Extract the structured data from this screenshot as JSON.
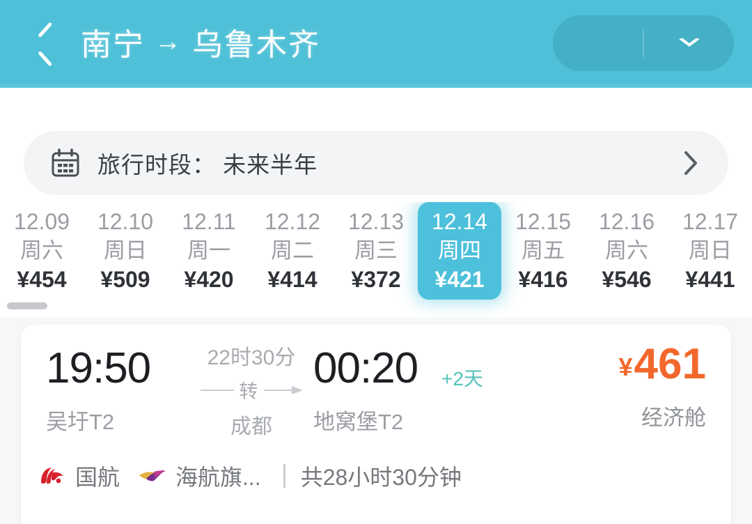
{
  "theme": {
    "header_teal": "#4EC0D7",
    "selected_teal": "#4DC0DB",
    "price_orange": "#F2682C",
    "accent_green": "#55C3BB",
    "muted_gray": "#9A9DA3"
  },
  "header": {
    "back_icon": "chevron-left-icon",
    "origin": "南宁",
    "arrow": "→",
    "destination": "乌鲁木齐",
    "capsule_menu_icon": "chevron-down-icon"
  },
  "filter": {
    "calendar_icon": "calendar-icon",
    "label": "旅行时段： 未来半年",
    "chevron_icon": "chevron-right-icon"
  },
  "dates": [
    {
      "date": "12.09",
      "weekday": "周六",
      "price": "¥454",
      "selected": false
    },
    {
      "date": "12.10",
      "weekday": "周日",
      "price": "¥509",
      "selected": false
    },
    {
      "date": "12.11",
      "weekday": "周一",
      "price": "¥420",
      "selected": false
    },
    {
      "date": "12.12",
      "weekday": "周二",
      "price": "¥414",
      "selected": false
    },
    {
      "date": "12.13",
      "weekday": "周三",
      "price": "¥372",
      "selected": false
    },
    {
      "date": "12.14",
      "weekday": "周四",
      "price": "¥421",
      "selected": true
    },
    {
      "date": "12.15",
      "weekday": "周五",
      "price": "¥416",
      "selected": false
    },
    {
      "date": "12.16",
      "weekday": "周六",
      "price": "¥546",
      "selected": false
    },
    {
      "date": "12.17",
      "weekday": "周日",
      "price": "¥441",
      "selected": false
    }
  ],
  "flight": {
    "depart_time": "19:50",
    "depart_airport": "吴圩T2",
    "transfer_duration": "22时30分",
    "transfer_label": "转",
    "transfer_city": "成都",
    "arrive_time": "00:20",
    "arrive_day_offset": "+2天",
    "arrive_airport": "地窝堡T2",
    "price_symbol": "¥",
    "price_value": "461",
    "cabin_class": "经济舱",
    "airlines": [
      {
        "name": "国航",
        "logo_icon": "air-china-logo-icon"
      },
      {
        "name": "海航旗...",
        "logo_icon": "hainan-airlines-logo-icon"
      }
    ],
    "total_duration": "共28小时30分钟"
  }
}
